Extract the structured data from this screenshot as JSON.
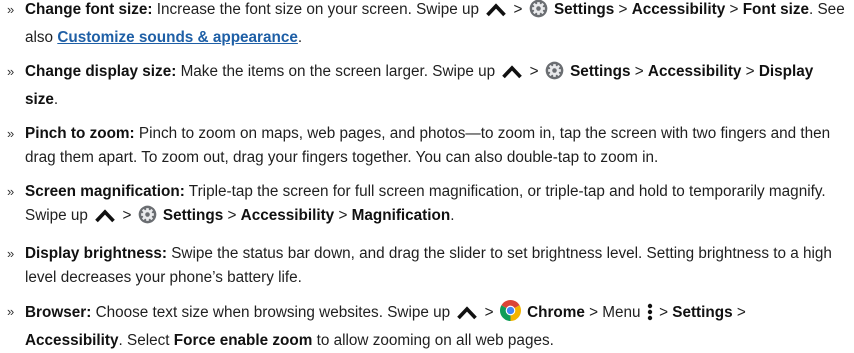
{
  "bullet": "»",
  "sep": ">",
  "items": [
    {
      "title": "Change font size:",
      "t1": "Increase the font size on your screen. Swipe up",
      "settings": "Settings",
      "accessibility": "Accessibility",
      "font_size": "Font size",
      "t2": ". See also",
      "link": "Customize sounds & appearance",
      "t3": "."
    },
    {
      "title": "Change display size:",
      "t1": "Make the items on the screen larger. Swipe up",
      "settings": "Settings",
      "accessibility": "Accessibility",
      "display_size": "Display size",
      "t2": "."
    },
    {
      "title": "Pinch to zoom:",
      "t1": "Pinch to zoom on maps, web pages, and photos—to zoom in, tap the screen with two fingers and then drag them apart. To zoom out, drag your fingers together. You can also double-tap to zoom in."
    },
    {
      "title": "Screen magnification:",
      "t1": "Triple-tap the screen for full screen magnification, or triple-tap and hold to temporarily magnify. Swipe up",
      "settings": "Settings",
      "accessibility": "Accessibility",
      "magnification": "Magnification",
      "t2": "."
    },
    {
      "title": "Display brightness:",
      "t1": "Swipe the status bar down, and drag the slider to set brightness level. Setting brightness to a high level decreases your phone’s battery life."
    },
    {
      "title": "Browser:",
      "t1": "Choose text size when browsing websites. Swipe up",
      "chrome": "Chrome",
      "menu": "Menu",
      "settings": "Settings",
      "accessibility": "Accessibility",
      "t2": ". Select",
      "force_zoom": "Force enable zoom",
      "t3": "to allow zooming on all web pages."
    }
  ],
  "icons": {
    "swipe_up": "chevron-up-icon",
    "settings": "settings-gear-icon",
    "chrome": "chrome-icon",
    "menu": "menu-dots-icon"
  }
}
